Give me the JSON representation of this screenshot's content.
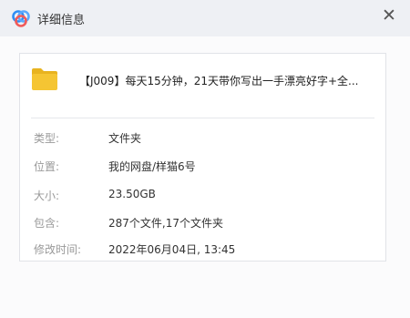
{
  "window": {
    "title": "详细信息",
    "close_glyph": "✕",
    "app_icon": "baidu-netdisk-logo-icon",
    "colors": {
      "titlebar_bg": "#eef0f4",
      "folder_yellow": "#f5c533",
      "logo_blue": "#2f8ef5",
      "logo_red": "#f05a5a"
    }
  },
  "file": {
    "name": "【J009】每天15分钟，21天带你写出一手漂亮好字+全...",
    "icon": "folder-icon"
  },
  "details": [
    {
      "label": "类型:",
      "value": "文件夹"
    },
    {
      "label": "位置:",
      "value": "我的网盘/样猫6号"
    },
    {
      "label": "大小:",
      "value": "23.50GB"
    },
    {
      "label": "包含:",
      "value": "287个文件,17个文件夹"
    },
    {
      "label": "修改时间:",
      "value": "2022年06月04日, 13:45"
    }
  ]
}
